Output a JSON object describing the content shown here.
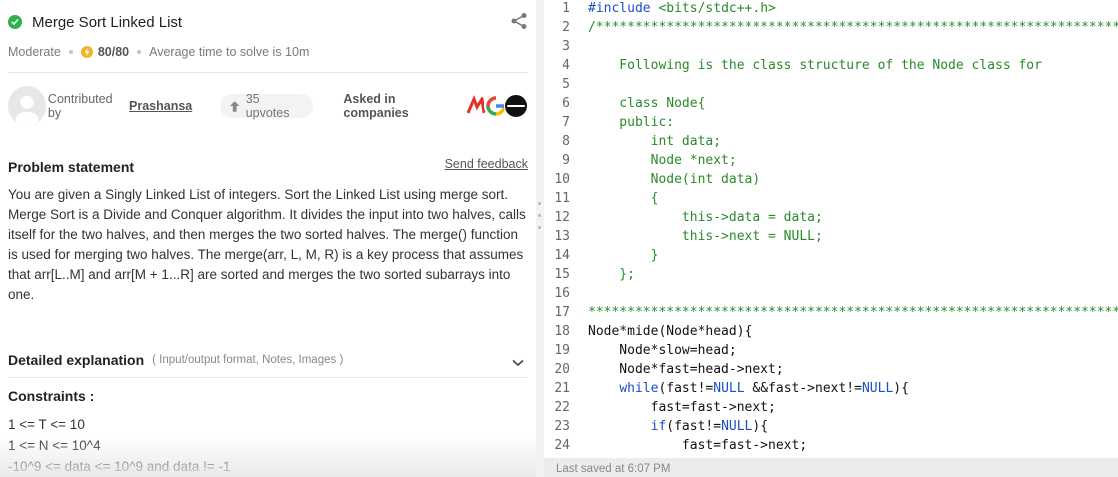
{
  "problem": {
    "title": "Merge Sort Linked List",
    "difficulty": "Moderate",
    "score": "80/80",
    "avg_time": "Average time to solve is 10m"
  },
  "contributor": {
    "prefix": "Contributed by",
    "name": "Prashansa",
    "upvotes": "35 upvotes",
    "asked_label": "Asked in companies"
  },
  "statement": {
    "heading": "Problem statement",
    "feedback_link": "Send feedback",
    "paragraphs": [
      "You are given a Singly Linked List of integers. Sort the Linked List using merge sort.",
      "Merge Sort is a Divide and Conquer algorithm. It divides the input into two halves, calls itself for the two halves, and then merges the two sorted halves. The merge() function is used for merging two halves. The merge(arr, L, M, R) is a key process that assumes that arr[L..M] and arr[M + 1...R] are sorted and merges the two sorted subarrays into one."
    ]
  },
  "detailed": {
    "title": "Detailed explanation",
    "subtitle": "( Input/output format, Notes, Images )"
  },
  "constraints": {
    "title": "Constraints :",
    "items": [
      "1 <= T <= 10",
      "1 <= N <= 10^4",
      "-10^9 <= data <= 10^9 and data != -1"
    ]
  },
  "editor": {
    "lines": [
      {
        "n": "1",
        "t": "#include <bits/stdc++.h>"
      },
      {
        "n": "2",
        "t": "/*********************************************************************"
      },
      {
        "n": "3",
        "t": ""
      },
      {
        "n": "4",
        "t": "    Following is the class structure of the Node class for"
      },
      {
        "n": "5",
        "t": ""
      },
      {
        "n": "6",
        "t": "    class Node{"
      },
      {
        "n": "7",
        "t": "    public:"
      },
      {
        "n": "8",
        "t": "        int data;"
      },
      {
        "n": "9",
        "t": "        Node *next;"
      },
      {
        "n": "10",
        "t": "        Node(int data)"
      },
      {
        "n": "11",
        "t": "        {"
      },
      {
        "n": "12",
        "t": "            this->data = data;"
      },
      {
        "n": "13",
        "t": "            this->next = NULL;"
      },
      {
        "n": "14",
        "t": "        }"
      },
      {
        "n": "15",
        "t": "    };"
      },
      {
        "n": "16",
        "t": ""
      },
      {
        "n": "17",
        "t": "*********************************************************************"
      },
      {
        "n": "18",
        "t": "Node*mide(Node*head){"
      },
      {
        "n": "19",
        "t": "    Node*slow=head;"
      },
      {
        "n": "20",
        "t": "    Node*fast=head->next;"
      },
      {
        "n": "21",
        "t": "    while(fast!=NULL &&fast->next!=NULL){"
      },
      {
        "n": "22",
        "t": "        fast=fast->next;"
      },
      {
        "n": "23",
        "t": "        if(fast!=NULL){"
      },
      {
        "n": "24",
        "t": "            fast=fast->next;"
      }
    ],
    "status": "Last saved at 6:07 PM"
  },
  "colors": {
    "comment": "#2a8a2a",
    "keyword": "#1a4fc9",
    "line_number": "#666666"
  }
}
